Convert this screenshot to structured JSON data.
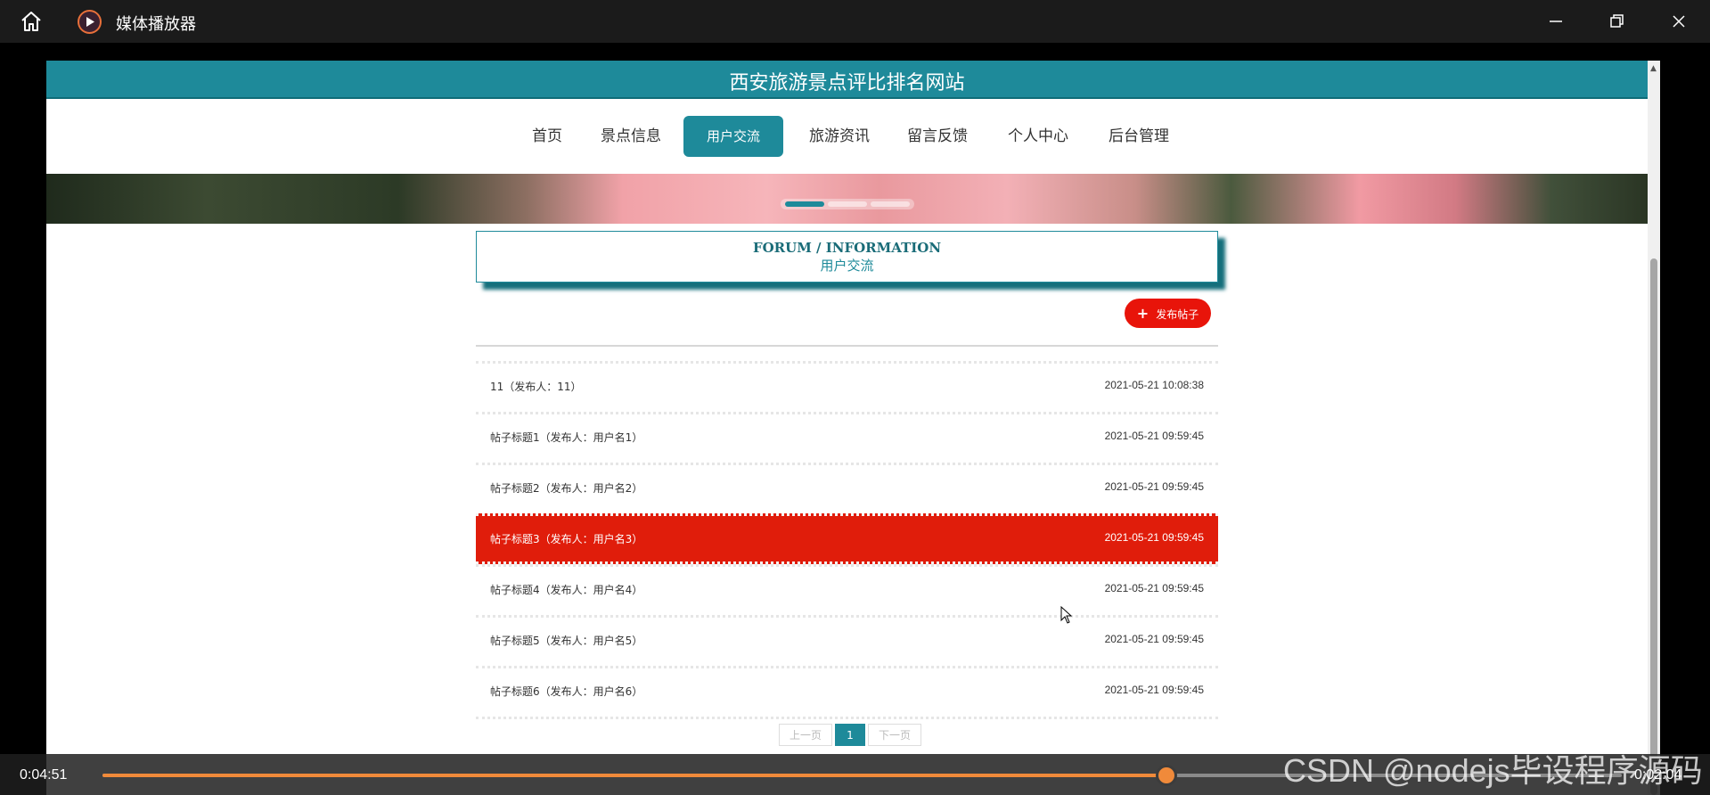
{
  "window": {
    "title": "媒体播放器",
    "icons": [
      "home-icon",
      "media-player-icon",
      "minimize-icon",
      "maximize-icon",
      "close-icon"
    ]
  },
  "site": {
    "title": "西安旅游景点评比排名网站",
    "nav": [
      "首页",
      "景点信息",
      "用户交流",
      "旅游资讯",
      "留言反馈",
      "个人中心",
      "后台管理"
    ],
    "active_nav": "用户交流",
    "accent_color": "#1e8a9a"
  },
  "forum": {
    "heading_en": "FORUM / INFORMATION",
    "heading_cn": "用户交流",
    "post_button": "发布帖子",
    "highlight_color": "#e01d0b",
    "posts": [
      {
        "title": "11（发布人：11）",
        "date": "2021-05-21 10:08:38"
      },
      {
        "title": "帖子标题1（发布人：用户名1）",
        "date": "2021-05-21 09:59:45"
      },
      {
        "title": "帖子标题2（发布人：用户名2）",
        "date": "2021-05-21 09:59:45"
      },
      {
        "title": "帖子标题3（发布人：用户名3）",
        "date": "2021-05-21 09:59:45"
      },
      {
        "title": "帖子标题4（发布人：用户名4）",
        "date": "2021-05-21 09:59:45"
      },
      {
        "title": "帖子标题5（发布人：用户名5）",
        "date": "2021-05-21 09:59:45"
      },
      {
        "title": "帖子标题6（发布人：用户名6）",
        "date": "2021-05-21 09:59:45"
      }
    ],
    "highlighted_index": 3
  },
  "pager": {
    "prev": "上一页",
    "current": "1",
    "next": "下一页"
  },
  "media": {
    "elapsed": "0:04:51",
    "remaining": "0:02:04",
    "progress": 0.7,
    "progress_color": "#f08a3a"
  },
  "watermark": "CSDN @nodejs毕设程序源码"
}
